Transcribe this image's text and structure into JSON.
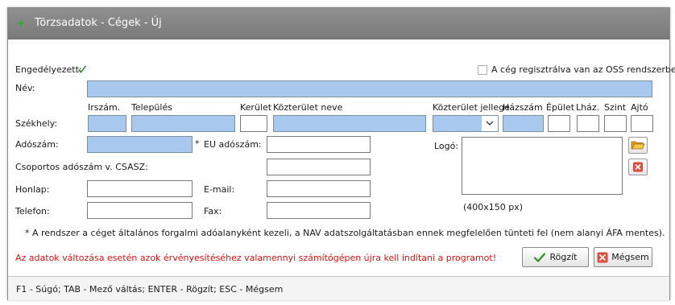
{
  "window": {
    "title": "Törzsadatok - Cégek - Új"
  },
  "form": {
    "approved_label": "Engedélyezett:",
    "oss_label": "A cég regisztrálva van az OSS rendszerbe",
    "name_label": "Név:",
    "headquarters_label": "Székhely:",
    "headers": {
      "zip": "Irszám.",
      "city": "Település",
      "district": "Kerület",
      "street_name": "Közterület neve",
      "street_type": "Közterület jellege",
      "house_number": "Házszám",
      "building": "Épület",
      "stairway": "Lház.",
      "floor": "Szint",
      "door": "Ajtó"
    },
    "tax_number_label": "Adószám:",
    "tax_asterisk": "*",
    "eu_tax_label": "EU adószám:",
    "group_tax_label": "Csoportos adószám v. CSASZ:",
    "website_label": "Honlap:",
    "email_label": "E-mail:",
    "phone_label": "Telefon:",
    "fax_label": "Fax:",
    "logo_label": "Logó:",
    "logo_size_hint": "(400x150 px)",
    "vat_note": "* A rendszer a céget általános forgalmi adóalanyként kezeli, a NAV adatszolgáltatásban ennek megfelelően tünteti fel (nem alanyi ÁFA mentes).",
    "warning": "Az adatok változása esetén azok érvényesítéséhez valamennyi számítógépen újra kell indítani a programot!"
  },
  "buttons": {
    "save": "Rögzít",
    "cancel": "Mégsem"
  },
  "status_bar": {
    "text": "F1 - Súgó; TAB - Mező váltás; ENTER - Rögzít; ESC - Mégsem"
  },
  "colors": {
    "required_field": "#a8c8ee",
    "warning": "#e01010",
    "title_bar": "#858585"
  }
}
